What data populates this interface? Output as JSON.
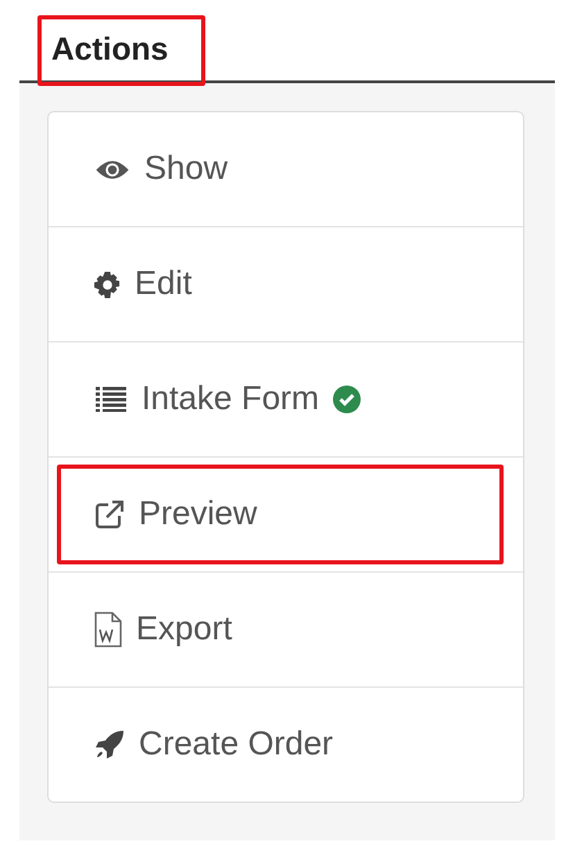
{
  "header": {
    "title": "Actions",
    "highlighted": true
  },
  "actions": [
    {
      "label": "Show",
      "highlighted": false,
      "completed": false
    },
    {
      "label": "Edit",
      "highlighted": false,
      "completed": false
    },
    {
      "label": "Intake Form",
      "highlighted": false,
      "completed": true
    },
    {
      "label": "Preview",
      "highlighted": true,
      "completed": false
    },
    {
      "label": "Export",
      "highlighted": false,
      "completed": false
    },
    {
      "label": "Create Order",
      "highlighted": false,
      "completed": false
    }
  ]
}
